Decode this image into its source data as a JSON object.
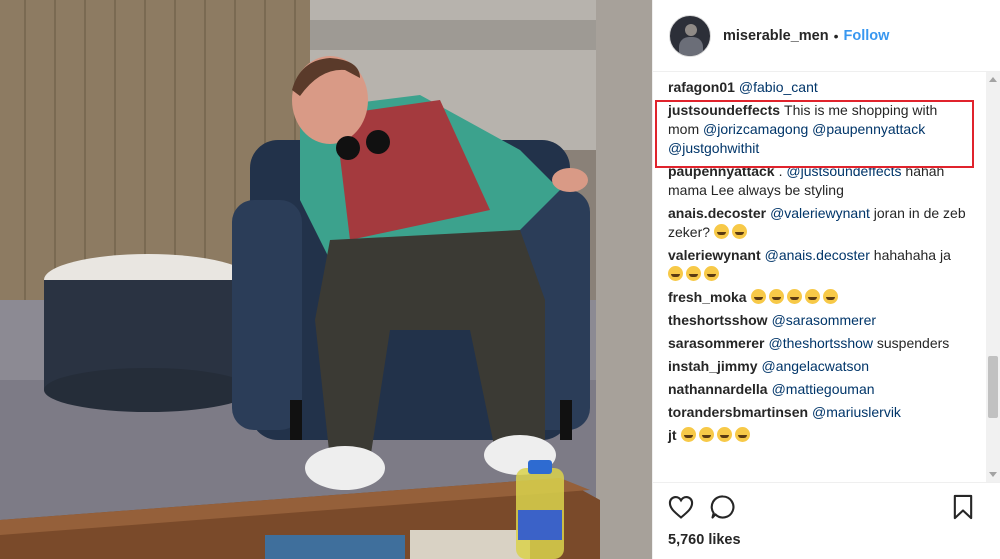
{
  "post": {
    "username": "miserable_men",
    "separator": "•",
    "follow_label": "Follow",
    "likes": "5,760 likes"
  },
  "comments": [
    {
      "author": "rafagon01",
      "parts": [
        {
          "t": "mention",
          "v": "@fabio_cant"
        }
      ]
    },
    {
      "author": "justsoundeffects",
      "highlighted": true,
      "parts": [
        {
          "t": "text",
          "v": "This is me shopping with mom "
        },
        {
          "t": "mention",
          "v": "@jorizcamagong"
        },
        {
          "t": "text",
          "v": " "
        },
        {
          "t": "mention",
          "v": "@paupennyattack"
        },
        {
          "t": "text",
          "v": " "
        },
        {
          "t": "mention",
          "v": "@justgohwithit"
        }
      ]
    },
    {
      "author": "paupennyattack",
      "parts": [
        {
          "t": "text",
          "v": ". "
        },
        {
          "t": "mention",
          "v": "@justsoundeffects"
        },
        {
          "t": "text",
          "v": " hahah mama Lee always be styling"
        }
      ]
    },
    {
      "author": "anais.decoster",
      "parts": [
        {
          "t": "mention",
          "v": "@valeriewynant"
        },
        {
          "t": "text",
          "v": " joran in de zeb zeker? "
        },
        {
          "t": "emoji",
          "v": "smirk-emoji"
        },
        {
          "t": "emoji",
          "v": "grin-sweat-emoji"
        }
      ]
    },
    {
      "author": "valeriewynant",
      "parts": [
        {
          "t": "mention",
          "v": "@anais.decoster"
        },
        {
          "t": "text",
          "v": " hahahaha ja "
        },
        {
          "t": "emoji",
          "v": "grin-sweat-emoji"
        },
        {
          "t": "emoji",
          "v": "grin-sweat-emoji"
        },
        {
          "t": "emoji",
          "v": "grin-sweat-emoji"
        }
      ]
    },
    {
      "author": "fresh_moka",
      "parts": [
        {
          "t": "emoji",
          "v": "grin-sweat-emoji"
        },
        {
          "t": "emoji",
          "v": "grin-sweat-emoji"
        },
        {
          "t": "emoji",
          "v": "grin-sweat-emoji"
        },
        {
          "t": "emoji",
          "v": "grin-sweat-emoji"
        },
        {
          "t": "emoji",
          "v": "grin-sweat-emoji"
        }
      ]
    },
    {
      "author": "theshortsshow",
      "parts": [
        {
          "t": "mention",
          "v": "@sarasommerer"
        }
      ]
    },
    {
      "author": "sarasommerer",
      "parts": [
        {
          "t": "mention",
          "v": "@theshortsshow"
        },
        {
          "t": "text",
          "v": " suspenders"
        }
      ]
    },
    {
      "author": "instah_jimmy",
      "parts": [
        {
          "t": "mention",
          "v": "@angelacwatson"
        }
      ]
    },
    {
      "author": "nathannardella",
      "parts": [
        {
          "t": "mention",
          "v": "@mattiegouman"
        }
      ]
    },
    {
      "author": "torandersbmartinsen",
      "parts": [
        {
          "t": "mention",
          "v": "@mariuslervik"
        }
      ]
    },
    {
      "author": "jt",
      "parts": [
        {
          "t": "emoji",
          "v": "grin-sweat-emoji"
        },
        {
          "t": "emoji",
          "v": "grin-sweat-emoji"
        },
        {
          "t": "emoji",
          "v": "grin-sweat-emoji"
        },
        {
          "t": "emoji",
          "v": "grin-sweat-emoji"
        }
      ]
    }
  ],
  "icons": {
    "like": "heart-icon",
    "comment": "comment-bubble-icon",
    "save": "bookmark-icon"
  },
  "colors": {
    "link": "#3897f0",
    "mention": "#003569",
    "highlight_border": "#e0232c",
    "text": "#262626"
  }
}
